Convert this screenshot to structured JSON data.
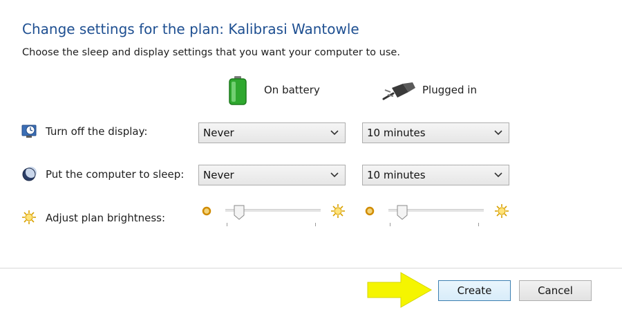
{
  "header": {
    "title": "Change settings for the plan: Kalibrasi Wantowle",
    "subtitle": "Choose the sleep and display settings that you want your computer to use."
  },
  "columns": {
    "on_battery": "On battery",
    "plugged_in": "Plugged in"
  },
  "settings": {
    "display": {
      "label": "Turn off the display:",
      "battery_value": "Never",
      "plugged_value": "10 minutes"
    },
    "sleep": {
      "label": "Put the computer to sleep:",
      "battery_value": "Never",
      "plugged_value": "10 minutes"
    },
    "brightness": {
      "label": "Adjust plan brightness:",
      "battery_level": 0.1,
      "plugged_level": 0.1
    }
  },
  "buttons": {
    "create": "Create",
    "cancel": "Cancel"
  },
  "colors": {
    "title": "#1e4f91",
    "annotation_arrow": "#f5f500",
    "battery": "#2fa82f"
  }
}
